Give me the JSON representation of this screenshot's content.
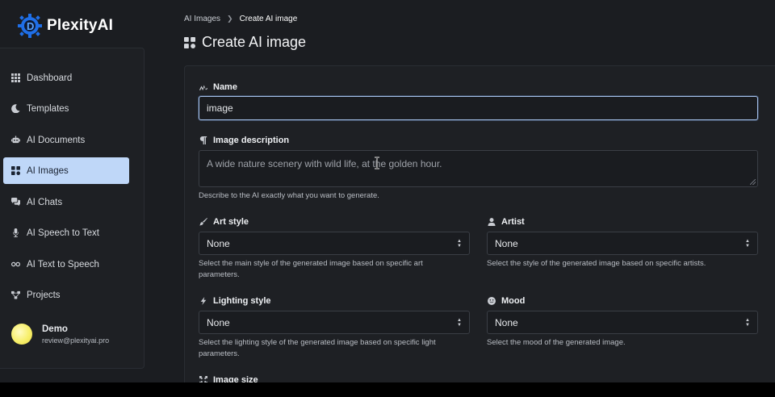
{
  "app": {
    "name": "PlexityAI"
  },
  "sidebar": {
    "items": [
      {
        "label": "Dashboard",
        "icon": "grid-icon",
        "active": false
      },
      {
        "label": "Templates",
        "icon": "moon-icon",
        "active": false
      },
      {
        "label": "AI Documents",
        "icon": "robot-icon",
        "active": false
      },
      {
        "label": "AI Images",
        "icon": "images-icon",
        "active": true
      },
      {
        "label": "AI Chats",
        "icon": "chat-icon",
        "active": false
      },
      {
        "label": "AI Speech to Text",
        "icon": "microphone-icon",
        "active": false
      },
      {
        "label": "AI Text to Speech",
        "icon": "voicemail-icon",
        "active": false
      },
      {
        "label": "Projects",
        "icon": "projects-icon",
        "active": false
      }
    ],
    "user": {
      "name": "Demo",
      "email": "review@plexityai.pro"
    }
  },
  "breadcrumb": {
    "parent": "AI Images",
    "current": "Create AI image"
  },
  "page": {
    "title": "Create AI image"
  },
  "form": {
    "name": {
      "label": "Name",
      "value": "image"
    },
    "description": {
      "label": "Image description",
      "placeholder": "A wide nature scenery with wild life, at the golden hour.",
      "help": "Describe to the AI exactly what you want to generate."
    },
    "art_style": {
      "label": "Art style",
      "value": "None",
      "help": "Select the main style of the generated image based on specific art parameters."
    },
    "artist": {
      "label": "Artist",
      "value": "None",
      "help": "Select the style of the generated image based on specific artists."
    },
    "lighting_style": {
      "label": "Lighting style",
      "value": "None",
      "help": "Select the lighting style of the generated image based on specific light parameters."
    },
    "mood": {
      "label": "Mood",
      "value": "None",
      "help": "Select the mood of the generated image."
    },
    "image_size": {
      "label": "Image size"
    }
  },
  "colors": {
    "accent_active": "#bfd7f8",
    "background": "#1b1d21",
    "focus_border": "#a8c4ee"
  }
}
